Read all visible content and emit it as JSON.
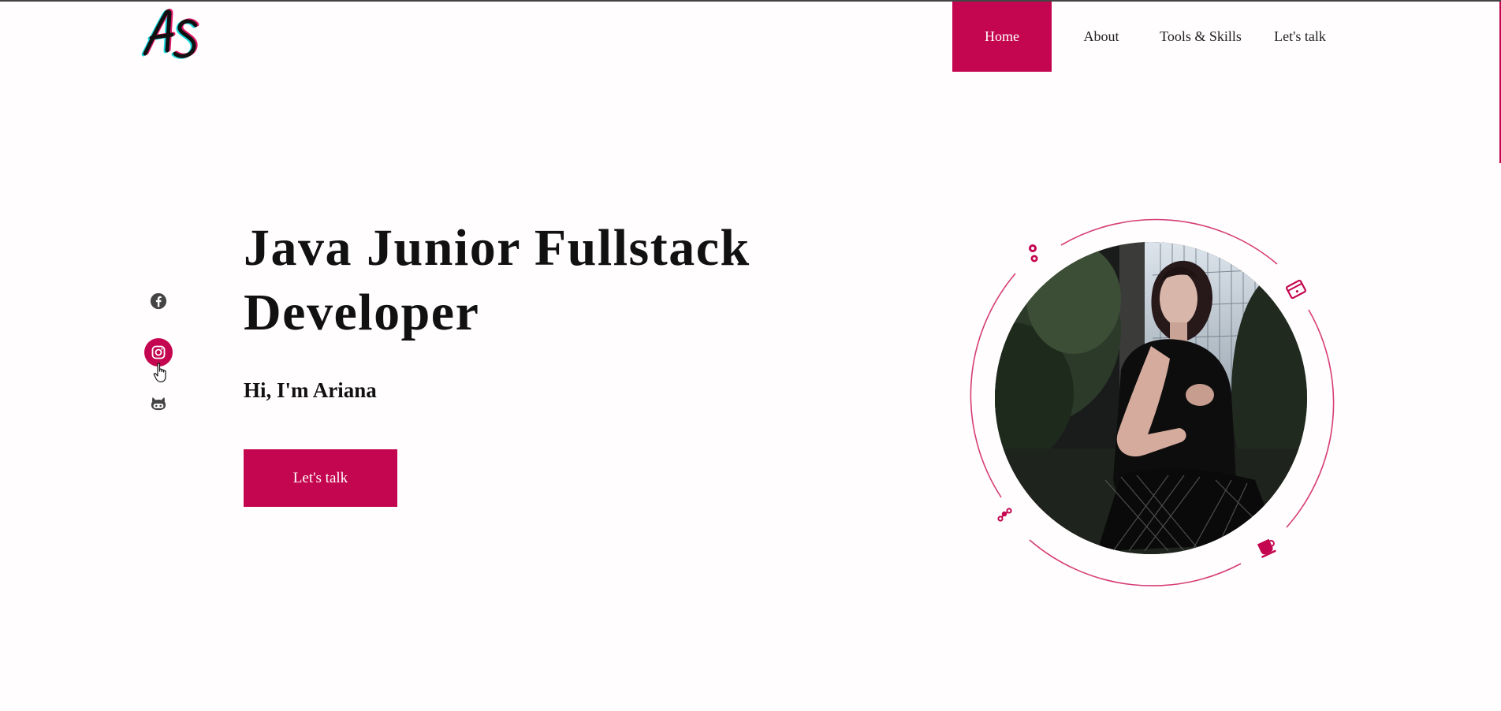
{
  "brand": {
    "logo_text": "AS",
    "accent_color": "#c4054f"
  },
  "nav": {
    "items": [
      {
        "label": "Home",
        "active": true
      },
      {
        "label": "About",
        "active": false
      },
      {
        "label": "Tools & Skills",
        "active": false
      },
      {
        "label": "Let's talk",
        "active": false
      }
    ]
  },
  "social": {
    "items": [
      {
        "icon": "facebook-icon"
      },
      {
        "icon": "instagram-icon",
        "hovered": true
      },
      {
        "icon": "github-icon"
      }
    ]
  },
  "hero": {
    "title": "Java Junior Fullstack Developer",
    "subtitle": "Hi, I'm Ariana",
    "cta_label": "Let's talk"
  },
  "portrait": {
    "orbit_icons": [
      "gear-icon",
      "code-window-icon",
      "git-branch-icon",
      "coffee-cup-icon"
    ]
  }
}
